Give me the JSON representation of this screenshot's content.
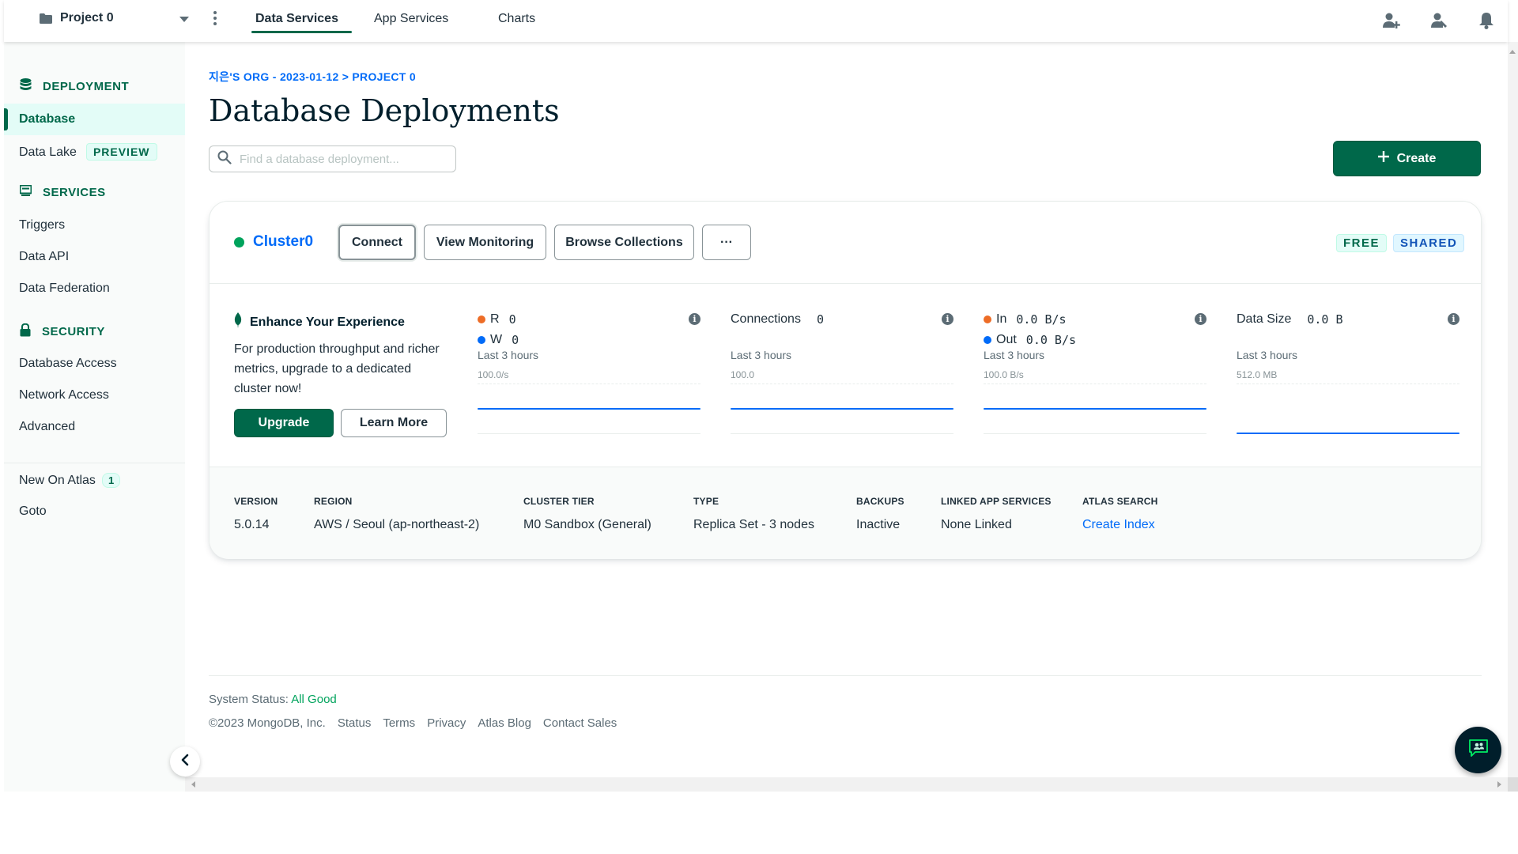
{
  "topbar": {
    "project_name": "Project 0",
    "tabs": [
      {
        "label": "Data Services",
        "active": true
      },
      {
        "label": "App Services",
        "active": false
      },
      {
        "label": "Charts",
        "active": false
      }
    ],
    "icons": [
      "invite-user-icon",
      "support-icon",
      "notifications-bell-icon"
    ]
  },
  "sidebar": {
    "sections": [
      {
        "title": "DEPLOYMENT",
        "icon": "database-icon"
      },
      {
        "title": "SERVICES",
        "icon": "services-icon"
      },
      {
        "title": "SECURITY",
        "icon": "lock-icon"
      }
    ],
    "deployment_items": [
      {
        "label": "Database",
        "active": true
      },
      {
        "label": "Data Lake",
        "badge": "PREVIEW"
      }
    ],
    "services_items": [
      "Triggers",
      "Data API",
      "Data Federation"
    ],
    "security_items": [
      "Database Access",
      "Network Access",
      "Advanced"
    ],
    "extra_items": [
      {
        "label": "New On Atlas",
        "count": "1"
      },
      {
        "label": "Goto"
      }
    ]
  },
  "main": {
    "breadcrumb": "지은'S ORG - 2023-01-12 > PROJECT 0",
    "title": "Database Deployments",
    "search_placeholder": "Find a database deployment...",
    "create_label": "Create"
  },
  "cluster": {
    "name": "Cluster0",
    "status_color": "#00a35c",
    "buttons": {
      "connect": "Connect",
      "view_monitoring": "View Monitoring",
      "browse_collections": "Browse Collections",
      "more": "···"
    },
    "tags": {
      "free": "FREE",
      "shared": "SHARED"
    },
    "enhance": {
      "title": "Enhance Your Experience",
      "text": "For production throughput and richer metrics, upgrade to a dedicated cluster now!",
      "upgrade": "Upgrade",
      "learn_more": "Learn More"
    },
    "metrics": {
      "ops": {
        "r_label": "R",
        "r_value": "0",
        "w_label": "W",
        "w_value": "0",
        "sub": "Last 3 hours",
        "scale": "100.0/s"
      },
      "connections": {
        "label": "Connections",
        "value": "0",
        "sub": "Last 3 hours",
        "scale": "100.0"
      },
      "network": {
        "in_label": "In",
        "in_value": "0.0 B/s",
        "out_label": "Out",
        "out_value": "0.0 B/s",
        "sub": "Last 3 hours",
        "scale": "100.0 B/s"
      },
      "data_size": {
        "label": "Data Size",
        "value": "0.0 B",
        "sub": "Last 3 hours",
        "scale": "512.0 MB"
      }
    },
    "details": [
      {
        "label": "VERSION",
        "value": "5.0.14"
      },
      {
        "label": "REGION",
        "value": "AWS / Seoul (ap-northeast-2)"
      },
      {
        "label": "CLUSTER TIER",
        "value": "M0 Sandbox (General)"
      },
      {
        "label": "TYPE",
        "value": "Replica Set - 3 nodes"
      },
      {
        "label": "BACKUPS",
        "value": "Inactive"
      },
      {
        "label": "LINKED APP SERVICES",
        "value": "None Linked"
      },
      {
        "label": "ATLAS SEARCH",
        "value": "Create Index"
      }
    ]
  },
  "footer": {
    "status_label": "System Status:",
    "status_value": "All Good",
    "links": [
      "©2023 MongoDB, Inc.",
      "Status",
      "Terms",
      "Privacy",
      "Atlas Blog",
      "Contact Sales"
    ]
  },
  "colors": {
    "primary_green": "#00684a",
    "link_blue": "#016bf8",
    "orange_dot": "#ed6c26",
    "blue_dot": "#016bf8"
  }
}
